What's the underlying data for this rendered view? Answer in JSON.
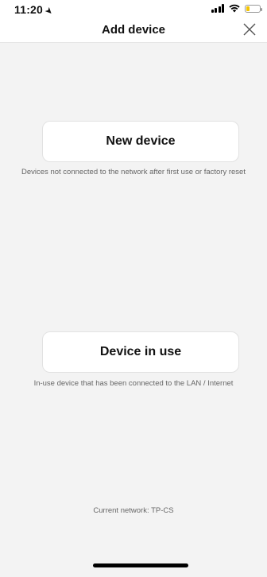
{
  "status_bar": {
    "time": "11:20",
    "location_icon": "location-arrow-icon",
    "signal_icon": "signal-icon",
    "wifi_icon": "wifi-icon",
    "battery_icon": "battery-icon",
    "battery_color": "#f4c400"
  },
  "header": {
    "title": "Add device",
    "close_icon": "close-icon"
  },
  "options": [
    {
      "label": "New device",
      "description": "Devices not connected to the network after first use or factory reset"
    },
    {
      "label": "Device in use",
      "description": "In-use device that has been connected to the LAN / Internet"
    }
  ],
  "footer": {
    "current_network_label": "Current network:",
    "current_network_value": "TP-CS"
  }
}
